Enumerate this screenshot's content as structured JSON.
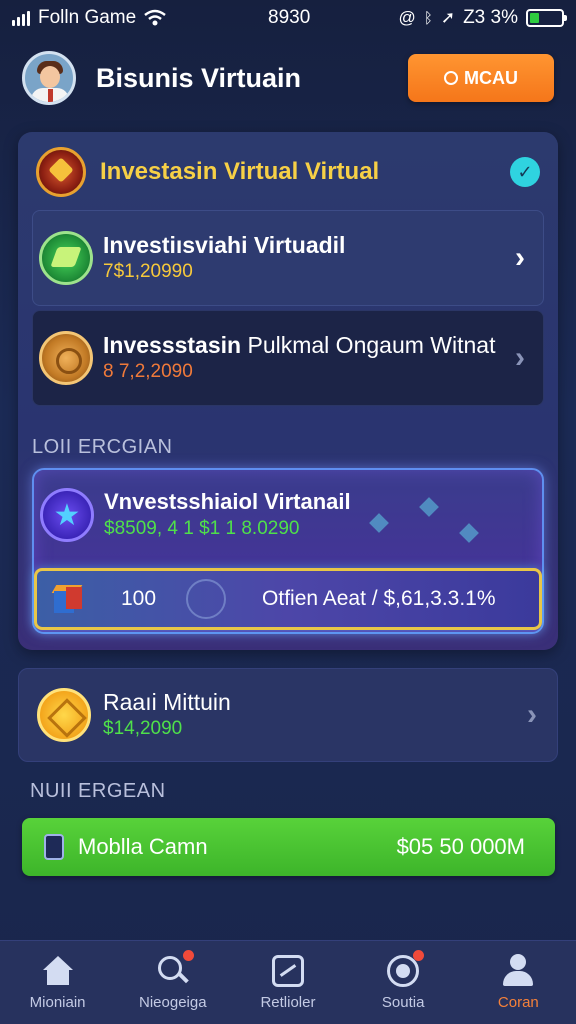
{
  "status_bar": {
    "carrier": "Folln Game",
    "time": "8930",
    "right_text": "Z3 3%",
    "right_icons": [
      "at-icon",
      "bluetooth-icon",
      "location-arrow-icon"
    ]
  },
  "header": {
    "title": "Bisunis Virtuain",
    "button_label": "MCAU"
  },
  "panel": {
    "title": "Investasin Virtual Virtual",
    "rows": [
      {
        "title": "Investiısviahi Virtuadil",
        "value": "7$1,20990"
      },
      {
        "title_bold": "Invessstasin",
        "title_light": " Pulkmal Ongaum Witnat",
        "value": "8 7,2,2090"
      }
    ],
    "section_label": "LOII ERCGIAN",
    "featured": {
      "title": "Vnvestsshiaiol Virtanail",
      "value": "$8509, 4 1 $1 1 8.0290",
      "trade_amount": "100",
      "trade_info": "Otfien Aeat / $,61,3.3.1%"
    }
  },
  "card2": {
    "title": "Raaıi Mittuin",
    "value": "$14,2090"
  },
  "section_label_2": "NUII ERGEAN",
  "green_button": {
    "label": "Moblla Camn",
    "value": "$05 50 000М"
  },
  "bottom_nav": [
    {
      "label": "Mioniain",
      "icon": "home-icon"
    },
    {
      "label": "Nieogeiga",
      "icon": "search-icon"
    },
    {
      "label": "Retlioler",
      "icon": "chart-icon"
    },
    {
      "label": "Soutia",
      "icon": "target-icon"
    },
    {
      "label": "Coran",
      "icon": "user-icon"
    }
  ],
  "colors": {
    "accent_orange": "#f5761a",
    "accent_gold": "#f7d046",
    "accent_green": "#4fe04a",
    "background": "#1b2a55"
  }
}
